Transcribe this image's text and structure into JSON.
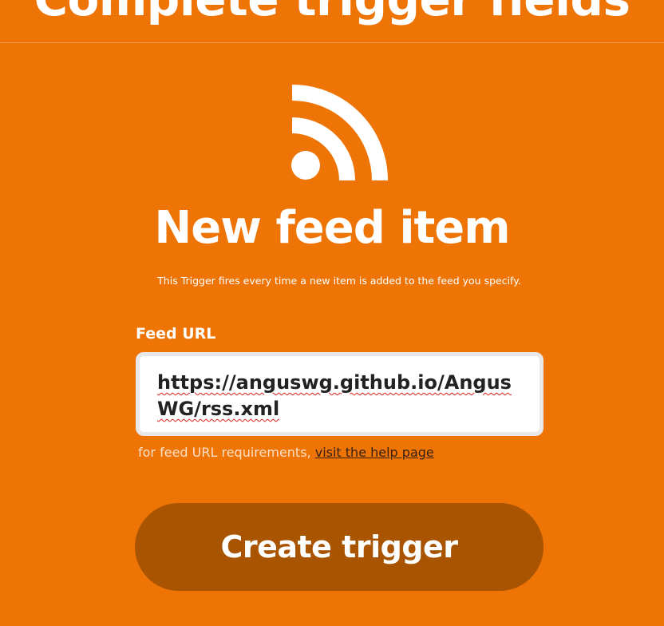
{
  "header": {
    "title": "Complete trigger fields"
  },
  "trigger": {
    "icon": "rss-feed-icon",
    "title": "New feed item",
    "description": "This Trigger fires every time a new item is added to the feed you specify."
  },
  "form": {
    "feed_url": {
      "label": "Feed URL",
      "value": "https://anguswg.github.io/AngusWG/rss.xml"
    },
    "help": {
      "prefix": "for feed URL requirements, ",
      "link_text": "visit the help page"
    },
    "submit_label": "Create trigger"
  },
  "colors": {
    "background": "#ee7405",
    "button": "#a85400",
    "text": "#ffffff"
  }
}
